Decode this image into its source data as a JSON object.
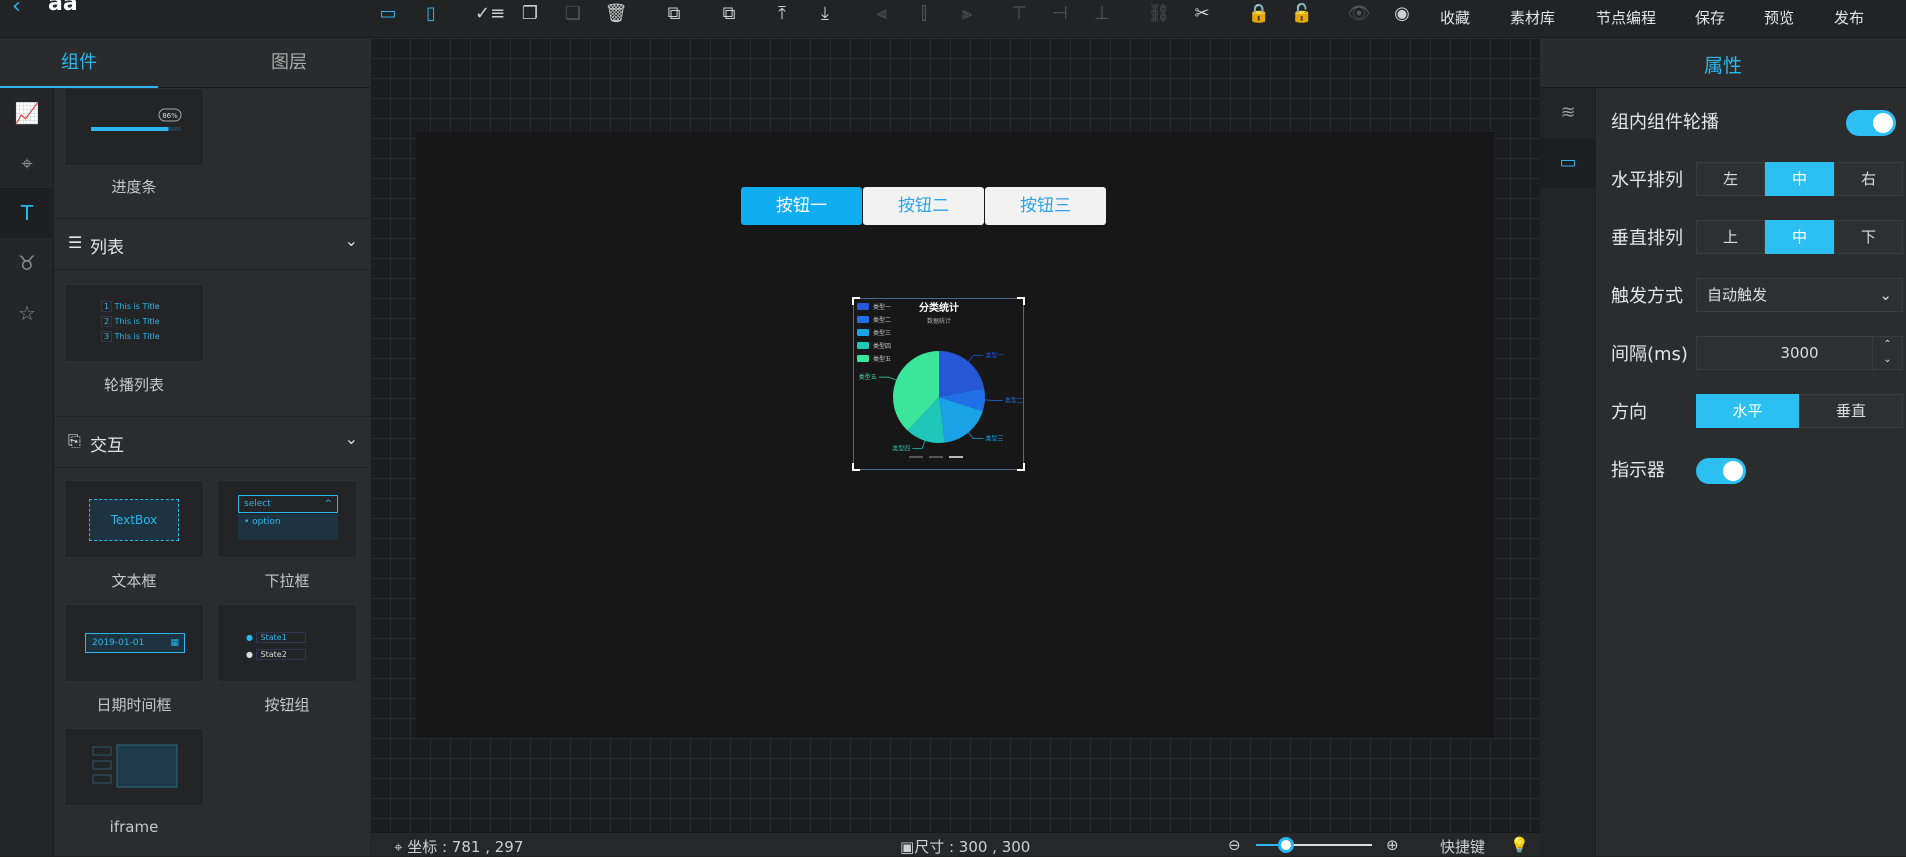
{
  "app": {
    "title": "aa",
    "back_icon": "back-arrow-icon"
  },
  "toolbar": {
    "tools": [
      {
        "name": "toggle-left-panel",
        "icon": "panel-left-icon",
        "state": "active"
      },
      {
        "name": "toggle-right-panel",
        "icon": "panel-right-icon",
        "state": "active"
      },
      {
        "name": "multi-select",
        "icon": "checklist-icon",
        "state": "normal"
      },
      {
        "name": "copy",
        "icon": "copy-icon",
        "state": "normal"
      },
      {
        "name": "paste",
        "icon": "paste-icon",
        "state": "dim"
      },
      {
        "name": "delete",
        "icon": "trash-icon",
        "state": "normal"
      },
      {
        "name": "layer-up",
        "icon": "layer-up-icon",
        "state": "normal"
      },
      {
        "name": "layer-down",
        "icon": "layer-down-icon",
        "state": "normal"
      },
      {
        "name": "bring-top",
        "icon": "top-icon",
        "state": "normal"
      },
      {
        "name": "send-bottom",
        "icon": "bottom-icon",
        "state": "normal"
      },
      {
        "name": "align-left",
        "icon": "align-left-icon",
        "state": "dim"
      },
      {
        "name": "align-center",
        "icon": "align-center-icon",
        "state": "dim"
      },
      {
        "name": "align-right",
        "icon": "align-right-icon",
        "state": "dim"
      },
      {
        "name": "align-top",
        "icon": "align-top-icon",
        "state": "dim"
      },
      {
        "name": "align-middle",
        "icon": "align-middle-icon",
        "state": "dim"
      },
      {
        "name": "align-bottom",
        "icon": "align-bottom-icon",
        "state": "dim"
      },
      {
        "name": "group",
        "icon": "link-icon",
        "state": "dim"
      },
      {
        "name": "ungroup",
        "icon": "unlink-icon",
        "state": "normal"
      },
      {
        "name": "lock",
        "icon": "lock-icon",
        "state": "normal"
      },
      {
        "name": "unlock",
        "icon": "unlock-icon",
        "state": "dim"
      },
      {
        "name": "show",
        "icon": "eye-icon",
        "state": "dim"
      },
      {
        "name": "hide",
        "icon": "eye-off-icon",
        "state": "normal"
      }
    ],
    "menu": [
      "收藏",
      "素材库",
      "节点编程",
      "保存",
      "预览",
      "发布"
    ]
  },
  "left": {
    "tabs": [
      "组件",
      "图层"
    ],
    "rail_icons": [
      "chart-icon",
      "map-pin-icon",
      "text-icon",
      "deer-icon",
      "star-icon"
    ],
    "progress_card": {
      "label": "进度条",
      "percent_text": "86%",
      "value": 0.86
    },
    "section_list": {
      "title": "列表"
    },
    "list_card": {
      "label": "轮播列表",
      "rows": [
        "This is Title",
        "This is Title",
        "This is Title"
      ],
      "nums": [
        "1",
        "2",
        "3"
      ]
    },
    "section_interact": {
      "title": "交互"
    },
    "textbox_card": {
      "label": "文本框",
      "text": "TextBox"
    },
    "select_card": {
      "label": "下拉框",
      "text": "select",
      "option": "option"
    },
    "date_card": {
      "label": "日期时间框",
      "text": "2019-01-01"
    },
    "radio_card": {
      "label": "按钮组",
      "opt1": "State1",
      "opt2": "State2"
    },
    "iframe_card": {
      "label": "iframe"
    }
  },
  "canvas": {
    "buttons": [
      "按钮一",
      "按钮二",
      "按钮三"
    ],
    "chart_widget": {
      "title": "分类统计",
      "subtitle": "数据统计",
      "legend": [
        "类型一",
        "类型二",
        "类型三",
        "类型四",
        "类型五"
      ]
    }
  },
  "chart_data": {
    "type": "pie",
    "title": "分类统计",
    "subtitle": "数据统计",
    "categories": [
      "类型一",
      "类型二",
      "类型三",
      "类型四",
      "类型五"
    ],
    "values": [
      22,
      8,
      18,
      14,
      38
    ],
    "colors": [
      "#2557d6",
      "#1f6fe6",
      "#1aa2e6",
      "#1fc7b8",
      "#3be59a"
    ]
  },
  "status": {
    "coord_label": "坐标 : 781 , 297",
    "size_label": "尺寸 : 300 , 300",
    "shortcut": "快捷键",
    "zoom_value": 0.26
  },
  "right": {
    "header": "属性",
    "rail_icons": [
      "layers-icon",
      "carousel-icon"
    ],
    "carousel_label": "组内组件轮播",
    "h_align_label": "水平排列",
    "h_align": [
      "左",
      "中",
      "右"
    ],
    "h_align_selected": "中",
    "v_align_label": "垂直排列",
    "v_align": [
      "上",
      "中",
      "下"
    ],
    "v_align_selected": "中",
    "trigger_label": "触发方式",
    "trigger_value": "自动触发",
    "interval_label": "间隔(ms)",
    "interval_value": "3000",
    "direction_label": "方向",
    "direction": [
      "水平",
      "垂直"
    ],
    "direction_selected": "水平",
    "indicator_label": "指示器"
  },
  "colors": {
    "accent": "#2bb6ef",
    "toggle": "#2cc0f2"
  }
}
